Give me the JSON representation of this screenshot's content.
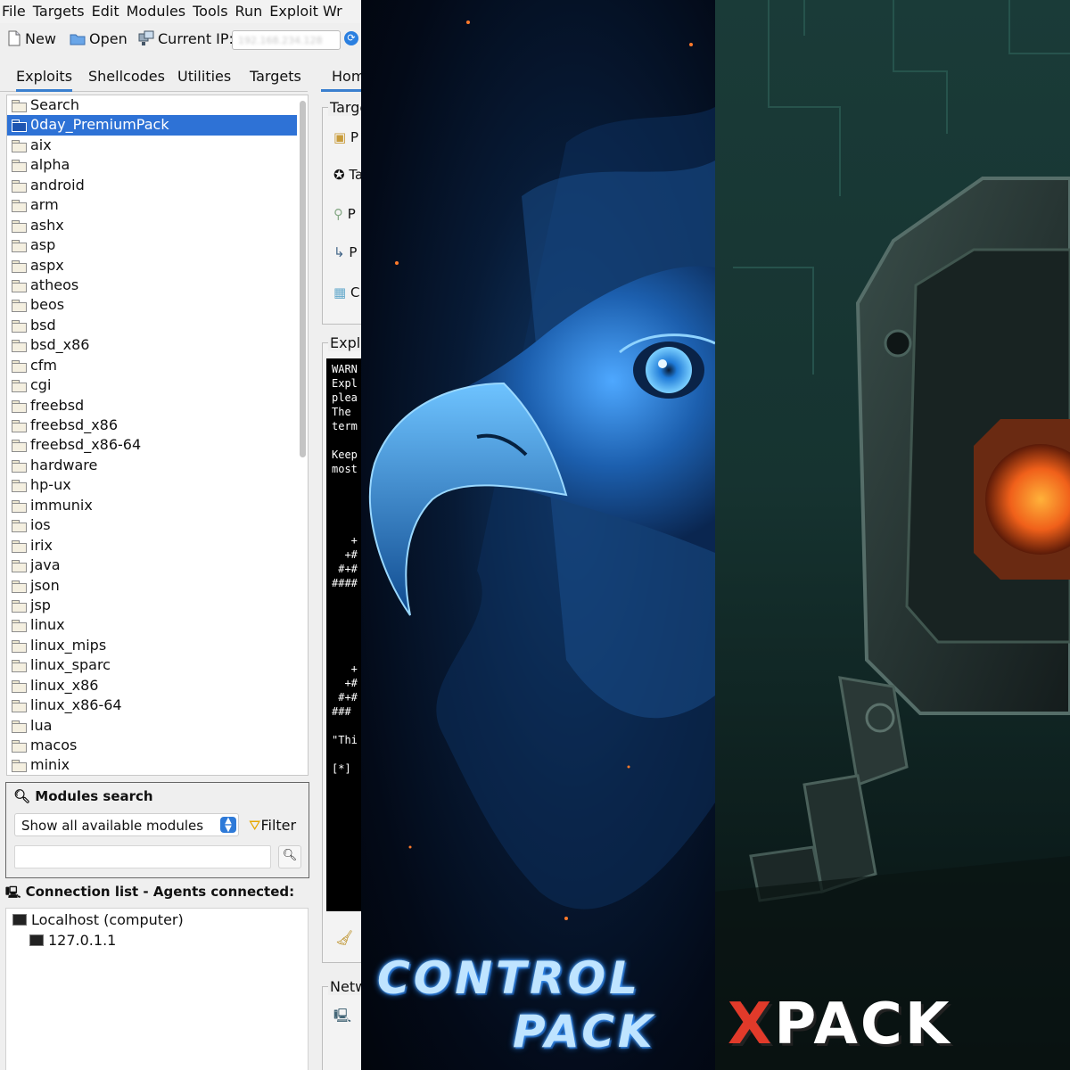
{
  "menu": [
    "File",
    "Targets",
    "Edit",
    "Modules",
    "Tools",
    "Run",
    "Exploit Wr"
  ],
  "toolbar": {
    "new_label": "New",
    "open_label": "Open",
    "ip_label": "Current IP:",
    "ip_value": "192.168.234.128"
  },
  "tabs": [
    "Exploits",
    "Shellcodes",
    "Utilities",
    "Targets"
  ],
  "tree_items": [
    "Search",
    "0day_PremiumPack",
    "aix",
    "alpha",
    "android",
    "arm",
    "ashx",
    "asp",
    "aspx",
    "atheos",
    "beos",
    "bsd",
    "bsd_x86",
    "cfm",
    "cgi",
    "freebsd",
    "freebsd_x86",
    "freebsd_x86-64",
    "hardware",
    "hp-ux",
    "immunix",
    "ios",
    "irix",
    "java",
    "json",
    "jsp",
    "linux",
    "linux_mips",
    "linux_sparc",
    "linux_x86",
    "linux_x86-64",
    "lua",
    "macos",
    "minix"
  ],
  "tree_selected": 1,
  "modules_search": {
    "title": "Modules search",
    "select_value": "Show all available modules",
    "filter_label": "Filter"
  },
  "connections": {
    "header": "Connection list - Agents connected:",
    "host": "Localhost (computer)",
    "ip": "127.0.1.1"
  },
  "right_panel": {
    "tab": "Hom",
    "targets_group": "Targe",
    "target_items": [
      "P",
      "Ta",
      "P",
      "P",
      "C"
    ],
    "exploit_group": "Explo",
    "terminal_lines": [
      "WARN",
      "Expl",
      "plea",
      "The",
      "term",
      "",
      "Keep",
      "most",
      "",
      "",
      "",
      "",
      "   +",
      "  +#",
      " #+#",
      "####",
      "",
      "",
      "",
      "",
      "",
      "   +",
      "  +#",
      " #+#",
      "###",
      "",
      "\"Thi",
      "",
      "[*]"
    ],
    "network_group": "Netw"
  },
  "brands": {
    "middle_line1": "CONTROL",
    "middle_line2": "PACK",
    "right_x": "X",
    "right_rest": "PACK"
  },
  "colors": {
    "selection": "#2e72d6",
    "tab_accent": "#3a7fcf",
    "xpack_red": "#e13a2a",
    "eagle_glow": "#2a8cff"
  }
}
